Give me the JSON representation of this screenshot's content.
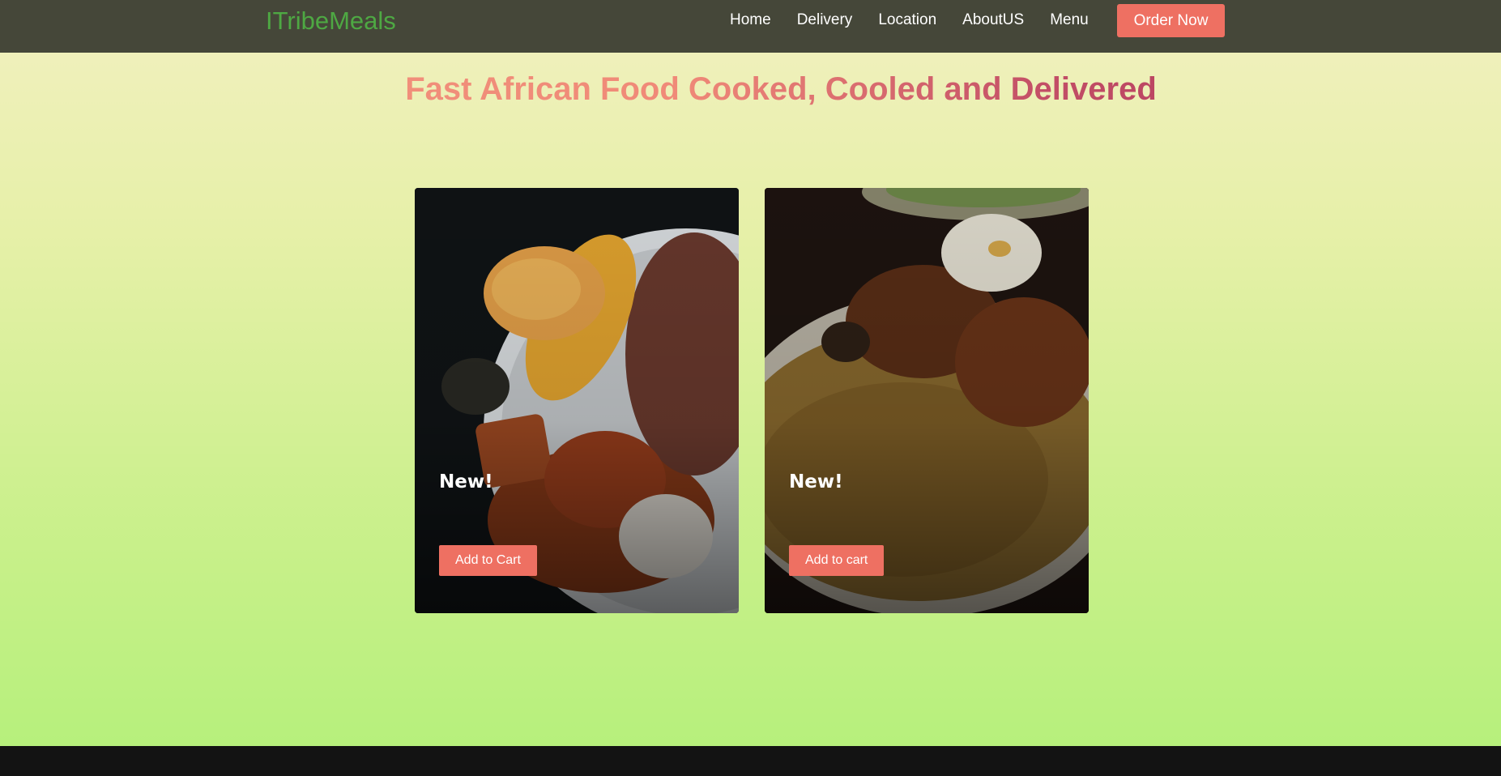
{
  "header": {
    "logo": "ITribeMeals",
    "nav": [
      {
        "label": "Home"
      },
      {
        "label": "Delivery"
      },
      {
        "label": "Location"
      },
      {
        "label": "AboutUS"
      },
      {
        "label": "Menu"
      }
    ],
    "order_button": "Order Now"
  },
  "hero": {
    "title": "Fast African Food Cooked, Cooled and Delivered"
  },
  "cards": [
    {
      "badge": "New!",
      "button": "Add to Cart",
      "image": "african-plate-spaghetti-beans-stew-egg"
    },
    {
      "badge": "New!",
      "button": "Add to cart",
      "image": "jollof-rice-chicken-egg"
    }
  ],
  "colors": {
    "navbar": "#454739",
    "logo": "#4ea843",
    "accent": "#ee7062",
    "footer": "#131313"
  }
}
